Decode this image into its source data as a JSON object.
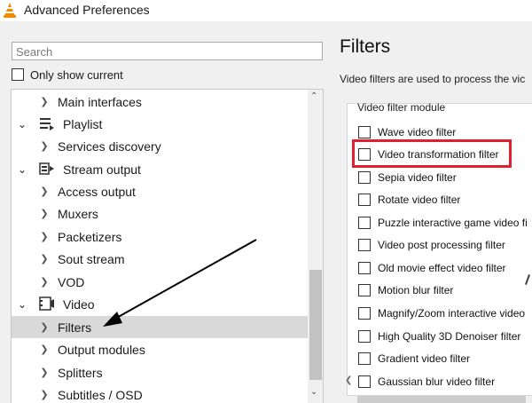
{
  "window": {
    "title": "Advanced Preferences",
    "app_icon": "vlc-cone-icon"
  },
  "left_pane": {
    "search_placeholder": "Search",
    "only_show_current_label": "Only show current",
    "only_show_current_checked": false,
    "tree_items": [
      {
        "label": "Main interfaces",
        "expanded": false,
        "level": 2
      },
      {
        "label": "Playlist",
        "expanded": true,
        "level": 1,
        "icon": "playlist-icon"
      },
      {
        "label": "Services discovery",
        "expanded": false,
        "level": 2
      },
      {
        "label": "Stream output",
        "expanded": true,
        "level": 1,
        "icon": "stream-output-icon"
      },
      {
        "label": "Access output",
        "expanded": false,
        "level": 2
      },
      {
        "label": "Muxers",
        "expanded": false,
        "level": 2
      },
      {
        "label": "Packetizers",
        "expanded": false,
        "level": 2
      },
      {
        "label": "Sout stream",
        "expanded": false,
        "level": 2
      },
      {
        "label": "VOD",
        "expanded": false,
        "level": 2
      },
      {
        "label": "Video",
        "expanded": true,
        "level": 1,
        "icon": "video-icon"
      },
      {
        "label": "Filters",
        "expanded": false,
        "level": 2,
        "selected": true
      },
      {
        "label": "Output modules",
        "expanded": false,
        "level": 2
      },
      {
        "label": "Splitters",
        "expanded": false,
        "level": 2
      },
      {
        "label": "Subtitles / OSD",
        "expanded": false,
        "level": 2
      }
    ]
  },
  "right_pane": {
    "title": "Filters",
    "description": "Video filters are used to process the vic",
    "group_label": "Video filter module",
    "filters": [
      {
        "label": "Wave video filter",
        "checked": false
      },
      {
        "label": "Video transformation filter",
        "checked": false,
        "highlighted": true
      },
      {
        "label": "Sepia video filter",
        "checked": false
      },
      {
        "label": "Rotate video filter",
        "checked": false
      },
      {
        "label": "Puzzle interactive game video fi",
        "checked": false
      },
      {
        "label": "Video post processing filter",
        "checked": false
      },
      {
        "label": "Old movie effect video filter",
        "checked": false
      },
      {
        "label": "Motion blur filter",
        "checked": false
      },
      {
        "label": "Magnify/Zoom interactive video",
        "checked": false
      },
      {
        "label": "High Quality 3D Denoiser filter",
        "checked": false
      },
      {
        "label": "Gradient video filter",
        "checked": false
      },
      {
        "label": "Gaussian blur video filter",
        "checked": false
      }
    ]
  },
  "colors": {
    "highlight": "#e0202f",
    "selection": "#d9d9d9",
    "pane_bg": "#f0f0f0",
    "annotation_arrow": "#000000"
  }
}
